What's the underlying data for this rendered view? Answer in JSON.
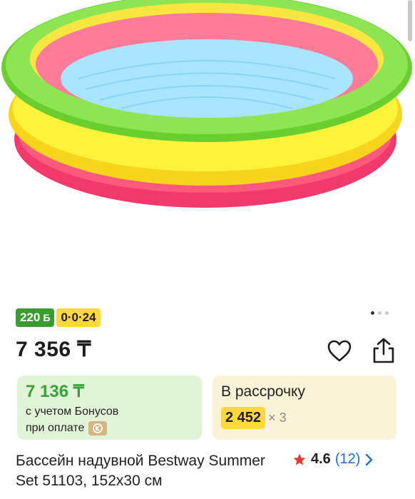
{
  "badges": {
    "bonus_amount": "220",
    "bonus_currency": "Б",
    "installment": "0·0·24"
  },
  "price": {
    "main": "7 356 ₸"
  },
  "bonus_card": {
    "price": "7 136 ₸",
    "note_line1": "с учетом Бонусов",
    "note_line2": "при оплате"
  },
  "installment_card": {
    "label": "В рассрочку",
    "amount": "2 452",
    "multiplier": "× 3"
  },
  "product": {
    "title": "Бассейн надувной Bestway Summer Set 51103, 152x30 см"
  },
  "rating": {
    "value": "4.6",
    "count": "(12)"
  },
  "carousel": {
    "slides": 3,
    "active_index": 0
  },
  "colors": {
    "green": "#3a9b2f",
    "yellow": "#ffd83d",
    "star": "#e53935",
    "link": "#1a6fd6"
  },
  "icons": [
    "heart-icon",
    "share-icon",
    "star-icon",
    "chevron-right-icon",
    "kaspi-icon"
  ]
}
